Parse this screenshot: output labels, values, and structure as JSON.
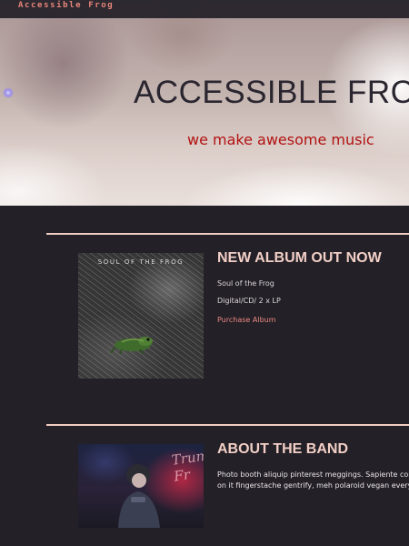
{
  "nav": {
    "brand": "Accessible Frog"
  },
  "hero": {
    "title": "ACCESSIBLE FROG",
    "subtitle": "we make awesome music"
  },
  "album": {
    "heading": "NEW ALBUM OUT NOW",
    "cover_text": "SOUL OF THE FROG",
    "name": "Soul of the Frog",
    "formats": "Digital/CD/ 2 x LP",
    "link_label": "Purchase Album"
  },
  "band": {
    "heading": "ABOUT THE BAND",
    "sign_text": "Trum Fr",
    "line1": "Photo booth aliquip pinterest meggings. Sapiente commo",
    "line2": "on it fingerstache gentrify, meh polaroid vegan everyday"
  },
  "colors": {
    "accent": "#e8857a",
    "hero_subtitle": "#b31212",
    "heading": "#f2cfc6",
    "rule": "#f0ccc3",
    "background": "#232027"
  }
}
